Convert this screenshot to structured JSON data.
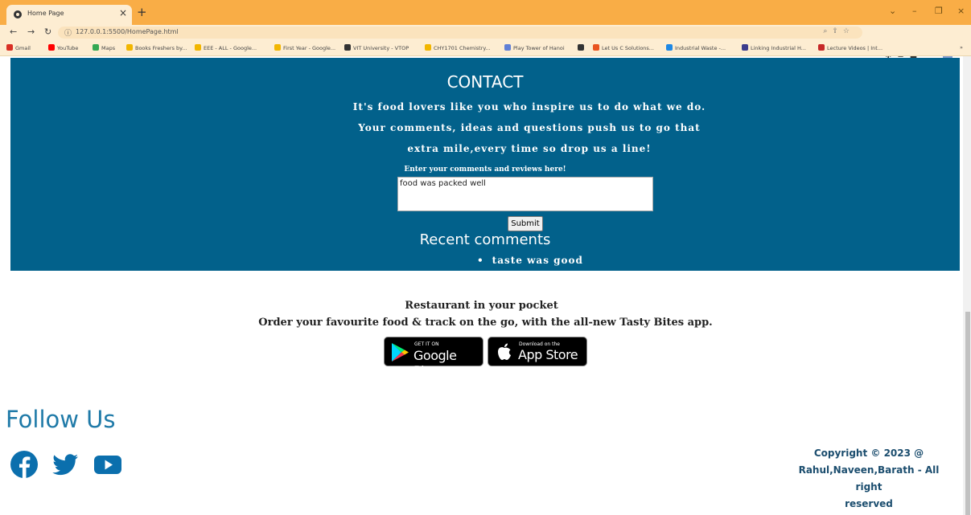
{
  "browser": {
    "tab_title": "Home Page",
    "tab_close": "×",
    "new_tab": "+",
    "url": "127.0.0.1:5500/HomePage.html",
    "window_controls": {
      "tabs_menu": "⌄",
      "minimize": "–",
      "restore": "❐",
      "close": "×"
    },
    "bookmarks": [
      {
        "label": "Gmail",
        "color": "#d93025"
      },
      {
        "label": "YouTube",
        "color": "#ff0000"
      },
      {
        "label": "Maps",
        "color": "#34a853"
      },
      {
        "label": "Books Freshers by...",
        "color": "#f2b600"
      },
      {
        "label": "EEE - ALL - Google...",
        "color": "#f2b600"
      },
      {
        "label": "First Year - Google...",
        "color": "#f2b600"
      },
      {
        "label": "VIT University - VTOP",
        "color": "#333333"
      },
      {
        "label": "CHY1701 Chemistry...",
        "color": "#f2b600"
      },
      {
        "label": "Play Tower of Hanoi",
        "color": "#5f7fd6"
      },
      {
        "label": "",
        "color": "#333333"
      },
      {
        "label": "Let Us C Solutions...",
        "color": "#e95420"
      },
      {
        "label": "Industrial Waste -...",
        "color": "#1e88e5"
      },
      {
        "label": "Linking Industrial H...",
        "color": "#3c3c8c"
      },
      {
        "label": "Lecture Videos | Int...",
        "color": "#c62828"
      }
    ],
    "bookmarks_more": "»"
  },
  "contact": {
    "heading": "CONTACT",
    "tagline": "It's food lovers like you who inspire us to do what we do. Your comments, ideas and questions push us to go that extra mile,every time so drop us a line!",
    "comment_label": "Enter your comments and reviews here!",
    "comment_value": "food was packed well",
    "submit_label": "Submit",
    "recent_heading": "Recent comments",
    "recent_comments": [
      "taste was good"
    ]
  },
  "app_promo": {
    "title": "Restaurant in your pocket",
    "description": "Order your favourite food & track on the go, with the all-new Tasty Bites app.",
    "google_play": {
      "small": "GET IT ON",
      "big": "Google Play"
    },
    "app_store": {
      "small": "Download on the",
      "big": "App Store"
    }
  },
  "footer": {
    "follow_heading": "Follow Us",
    "social_icons": [
      "facebook-icon",
      "twitter-icon",
      "youtube-icon"
    ],
    "social_color": "#0b6fad",
    "copyright_line1": "Copyright © 2023 @",
    "copyright_line2": "Rahul,Naveen,Barath - All right",
    "copyright_line3": "reserved"
  },
  "colors": {
    "contact_bg": "#02618b",
    "tabbar": "#f9ad46",
    "heading_blue": "#1f7aa8"
  }
}
